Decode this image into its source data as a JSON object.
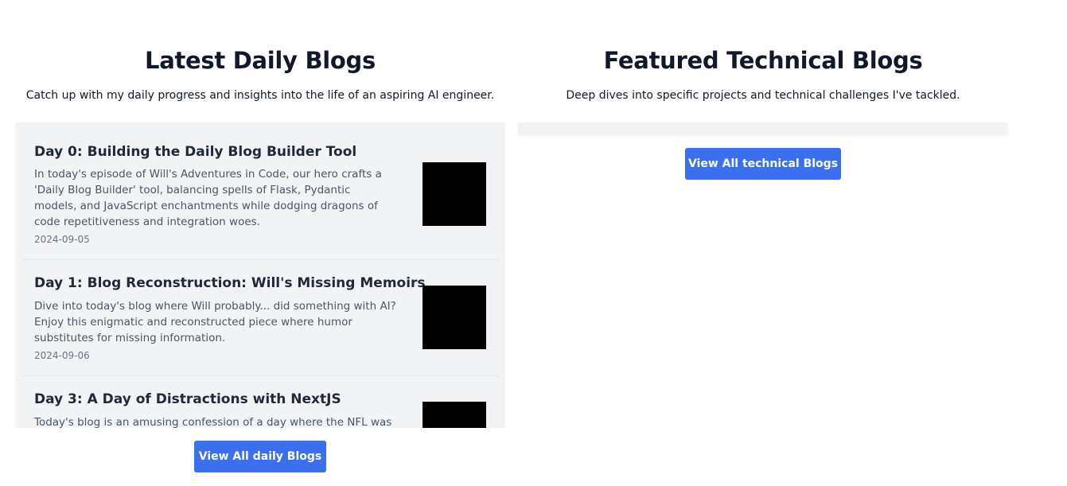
{
  "daily": {
    "title": "Latest Daily Blogs",
    "subtitle": "Catch up with my daily progress and insights into the life of an aspiring AI engineer.",
    "posts": [
      {
        "title": "Day 0: Building the Daily Blog Builder Tool",
        "summary": "In today's episode of Will's Adventures in Code, our hero crafts a 'Daily Blog Builder' tool, balancing spells of Flask, Pydantic models, and JavaScript enchantments while dodging dragons of code repetitiveness and integration woes.",
        "date": "2024-09-05"
      },
      {
        "title": "Day 1: Blog Reconstruction: Will's Missing Memoirs",
        "summary": "Dive into today's blog where Will probably... did something with AI? Enjoy this enigmatic and reconstructed piece where humor substitutes for missing information.",
        "date": "2024-09-06"
      },
      {
        "title": "Day 3: A Day of Distractions with NextJS",
        "summary": "Today's blog is an amusing confession of a day where the NFL was",
        "date": ""
      }
    ],
    "view_all_label": "View All daily Blogs"
  },
  "technical": {
    "title": "Featured Technical Blogs",
    "subtitle": "Deep dives into specific projects and technical challenges I've tackled.",
    "view_all_label": "View All technical Blogs"
  },
  "colors": {
    "accent": "#3b6ff0",
    "panel_bg": "#f2f3f5",
    "heading": "#111827"
  }
}
